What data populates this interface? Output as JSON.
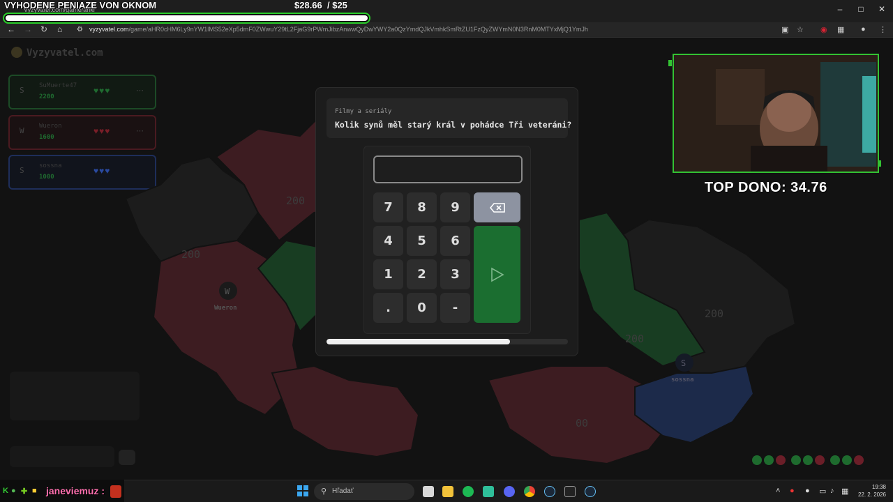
{
  "overlay": {
    "title": "VYHODENE PENIAZE VON OKNOM",
    "money_raised": "$28.66",
    "money_goal": "/ $25",
    "goal_progress": 1.0,
    "top_dono": "TOP DONO: 34.76"
  },
  "browser": {
    "tab_title": "Vyzyvatel.com/game/anki",
    "url_domain": "vyzyvatel.com",
    "url_path": "/game/aHR0cHM6Ly9nYW1lMS52eXp5dmF0ZWwuY29tL2FjaG9rPWmJibzAnwwQyDwYWY2a0QzYmdQJkVmhkSmRtZU1FzQyZWYmN0N3RnM0MTYxMjQ1YmJh"
  },
  "game": {
    "logo": "Vyzyvatel.com",
    "players": [
      {
        "initial": "S",
        "name": "SuMuerte47",
        "score": "2200",
        "hearts": "♥♥♥",
        "color": "#1e7a32"
      },
      {
        "initial": "W",
        "name": "Wueron",
        "score": "1600",
        "hearts": "♥♥♥",
        "color": "#8b1e2b"
      },
      {
        "initial": "S",
        "name": "sossna",
        "score": "1000",
        "hearts": "♥♥♥",
        "color": "#2a4aa0"
      }
    ],
    "map_labels": {
      "r1": "200",
      "r2": "200",
      "r3": "200",
      "r4": "200",
      "r5": "00",
      "wueron_initial": "W",
      "wueron_name": "Wueron",
      "sossna_initial": "S",
      "sossna_name": "sossna"
    },
    "history_colors": [
      "#1e6b2e",
      "#1e6b2e",
      "#6b1e28",
      "#1e6b2e",
      "#1e6b2e",
      "#6b1e28",
      "#1e6b2e",
      "#1e6b2e",
      "#6b1e28"
    ]
  },
  "question": {
    "category": "Filmy a seriály",
    "text": "Kolik synů měl starý král v pohádce Tři veteráni?",
    "answer_value": "",
    "keys": [
      "7",
      "8",
      "9",
      "4",
      "5",
      "6",
      "1",
      "2",
      "3",
      ".",
      "0",
      "-"
    ],
    "timer_fraction": 0.76
  },
  "chat": {
    "username": "janeviemuz :"
  },
  "taskbar": {
    "search_placeholder": "Hľadať",
    "time": "19:38",
    "date": "22. 2. 2026"
  }
}
